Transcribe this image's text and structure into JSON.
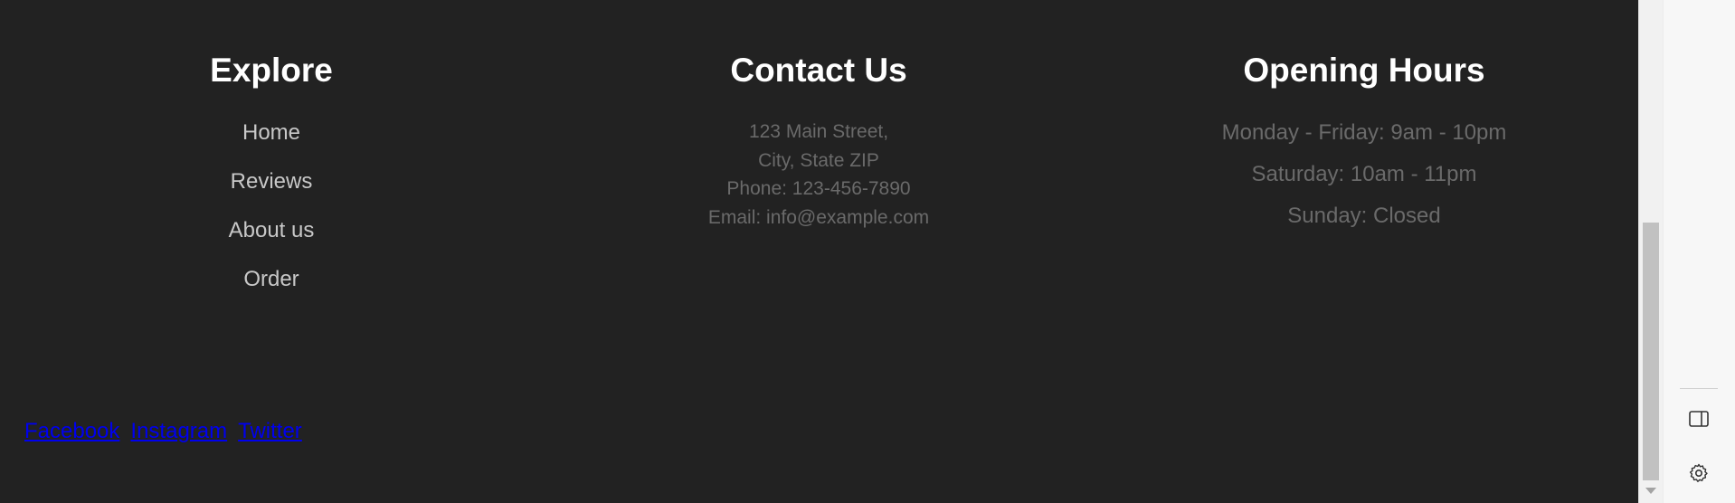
{
  "footer": {
    "explore": {
      "title": "Explore",
      "links": [
        "Home",
        "Reviews",
        "About us",
        "Order"
      ]
    },
    "contact": {
      "title": "Contact Us",
      "address_line1": "123 Main Street,",
      "address_line2": "City, State ZIP",
      "phone": "Phone: 123-456-7890",
      "email": "Email: info@example.com"
    },
    "hours": {
      "title": "Opening Hours",
      "lines": [
        "Monday - Friday: 9am - 10pm",
        "Saturday: 10am - 11pm",
        "Sunday: Closed"
      ]
    },
    "social": [
      "Facebook",
      "Instagram",
      "Twitter"
    ]
  },
  "sidebar": {
    "icons": [
      "sidebar-panel-icon",
      "gear-icon"
    ]
  },
  "colors": {
    "background": "#222222",
    "heading": "#ffffff",
    "link": "#c8c8c8",
    "muted_text": "#6a6a6a",
    "social_link": "#0000ee"
  }
}
